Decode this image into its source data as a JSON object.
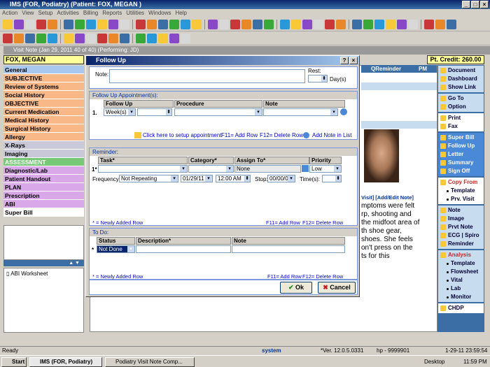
{
  "app": {
    "title": "IMS (FOR, Podiatry)    (Patient: FOX, MEGAN )",
    "menu": [
      "Action",
      "View",
      "Setup",
      "Activities",
      "Billing",
      "Reports",
      "Utilities",
      "Windows",
      "Help"
    ]
  },
  "visit": {
    "bar_title": "Visit Note (Jan 29, 2011   40 of 40) (Performing: JD)",
    "patient_name": "FOX, MEGAN",
    "pt_credit": "Pt. Credit:  260.00",
    "reminder_header": "QReminder",
    "pm_label": "PM",
    "visit_header": "Visit]  [Add/Edit Note]",
    "note_text": [
      "mptoms were felt",
      "rp, shooting and",
      "the midfoot area of",
      "th shoe gear,",
      "shoes. She feels",
      "on't press on the",
      "ts for this"
    ]
  },
  "leftnav": [
    {
      "label": "General",
      "c": "nav-blue"
    },
    {
      "label": "SUBJECTIVE",
      "c": "nav-orange"
    },
    {
      "label": "Review of Systems",
      "c": "nav-orange"
    },
    {
      "label": "Social History",
      "c": "nav-orange"
    },
    {
      "label": "OBJECTIVE",
      "c": "nav-orange"
    },
    {
      "label": "Current Medication",
      "c": "nav-orange"
    },
    {
      "label": "Medical History",
      "c": "nav-orange"
    },
    {
      "label": "Surgical History",
      "c": "nav-orange"
    },
    {
      "label": "Allergy",
      "c": "nav-orange"
    },
    {
      "label": "X-Rays",
      "c": "nav-gray"
    },
    {
      "label": "Imaging",
      "c": "nav-gray"
    },
    {
      "label": "ASSESSMENT",
      "c": "nav-green"
    },
    {
      "label": "Diagnostic/Lab",
      "c": "nav-purple"
    },
    {
      "label": "Patient Handout",
      "c": "nav-purple"
    },
    {
      "label": "PLAN",
      "c": "nav-purple"
    },
    {
      "label": "Prescription",
      "c": "nav-purple"
    },
    {
      "label": "ABI",
      "c": "nav-purple"
    },
    {
      "label": "Super Bill",
      "c": "nav-white"
    }
  ],
  "abi_worksheet": "ABI Worksheet",
  "rightnav": {
    "block1": [
      "Document",
      "Dashboard",
      "Show Link"
    ],
    "block2": [
      "Go To",
      "Option"
    ],
    "block3": [
      "Print",
      "Fax"
    ],
    "block4": [
      "Super Bill",
      "Follow Up",
      "Letter",
      "Summary",
      "Sign Off"
    ],
    "block5_head": "Copy From",
    "block5_subs": [
      "Template",
      "Prv. Visit"
    ],
    "block6": [
      "Note",
      "Image",
      "Prvt Note",
      "ECG | Spiro",
      "Reminder"
    ],
    "block7_head": "Analysis",
    "block7_subs": [
      "Template",
      "Flowsheet",
      "Vital",
      "Lab",
      "Monitor"
    ],
    "block8": [
      "CHDP"
    ]
  },
  "dialog": {
    "title": "Follow Up",
    "note_label": "Note:",
    "rest_label": "Rest:",
    "days_label": "Day(s)",
    "followup_group": "Follow Up Appointment(s):",
    "followup_headers": [
      "Follow Up",
      "Procedure",
      "Note"
    ],
    "row_num": "1.",
    "followup_unit": "Week(s)",
    "setup_link": "Click here to setup appointment",
    "f11_add": "F11= Add Row",
    "f12_delete": "F12= Delete Row",
    "add_note_link": "Add Note in List",
    "reminder_group": "Reminder:",
    "reminder_headers": [
      "Task*",
      "Category*",
      "Assign To*",
      "Priority"
    ],
    "reminder_row_num": "1*",
    "assign_to": "None",
    "priority": "Low",
    "frequency_label": "Frequency:",
    "frequency": "Not Repeating",
    "date": "01/29/11",
    "time": "12:00 AM",
    "stop_label": "Stop:",
    "stop_date": "00/00/00",
    "times_label": "Time(s):",
    "new_row_note": "* = Newly Added Row",
    "todo_group": "To Do:",
    "todo_headers": [
      "Status",
      "Description*",
      "Note"
    ],
    "todo_row_num": "*",
    "todo_status": "Not Done",
    "ok_label": "Ok",
    "cancel_label": "Cancel"
  },
  "status": {
    "left": "Ready",
    "user": "system",
    "version": "*Ver. 12.0.5.0331",
    "hp": "hp - 9999901",
    "datetime": "1-29-11 23:59:54"
  },
  "taskbar": {
    "start": "Start",
    "task1": "IMS (FOR, Podiatry)",
    "task2": "Podiatry Visit Note Comp...",
    "desktop": "Desktop",
    "clock": "11:59 PM"
  }
}
